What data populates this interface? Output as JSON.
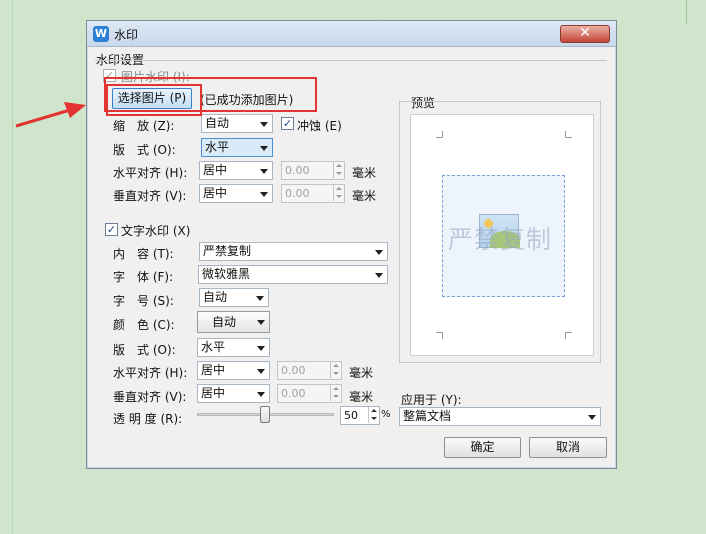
{
  "dialog": {
    "title": "水印",
    "app_icon_letter": "W",
    "close_symbol": "✕"
  },
  "settings_group_label": "水印设置",
  "picture_wm": {
    "checkbox_label": "图片水印 (I):",
    "checked": true,
    "select_button": "选择图片 (P)",
    "status": "(已成功添加图片)",
    "scale_label": "缩　放 (Z):",
    "scale_value": "自动",
    "washout_label": "冲蚀 (E)",
    "washout_checked": true,
    "layout_label": "版　式 (O):",
    "layout_value": "水平",
    "h_align_label": "水平对齐 (H):",
    "h_align_value": "居中",
    "h_offset": "0.00",
    "v_align_label": "垂直对齐 (V):",
    "v_align_value": "居中",
    "v_offset": "0.00",
    "unit": "毫米"
  },
  "text_wm": {
    "checkbox_label": "文字水印 (X)",
    "checked": true,
    "content_label": "内　容 (T):",
    "content_value": "严禁复制",
    "font_label": "字　体 (F):",
    "font_value": "微软雅黑",
    "size_label": "字　号 (S):",
    "size_value": "自动",
    "color_label": "颜　色 (C):",
    "color_value": "自动",
    "layout_label": "版　式 (O):",
    "layout_value": "水平",
    "h_align_label": "水平对齐 (H):",
    "h_align_value": "居中",
    "h_offset": "0.00",
    "v_align_label": "垂直对齐 (V):",
    "v_align_value": "居中",
    "v_offset": "0.00",
    "unit": "毫米",
    "transparency_label": "透 明 度 (R):",
    "transparency_value": "50",
    "transparency_percent": 50,
    "percent_sign": "%"
  },
  "preview": {
    "label": "预览",
    "watermark_text": "严禁复制"
  },
  "apply_to": {
    "label": "应用于 (Y):",
    "value": "整篇文档"
  },
  "buttons": {
    "ok": "确定",
    "cancel": "取消"
  },
  "colors": {
    "annotation": "#e43333",
    "background": "#cfe6cc"
  }
}
